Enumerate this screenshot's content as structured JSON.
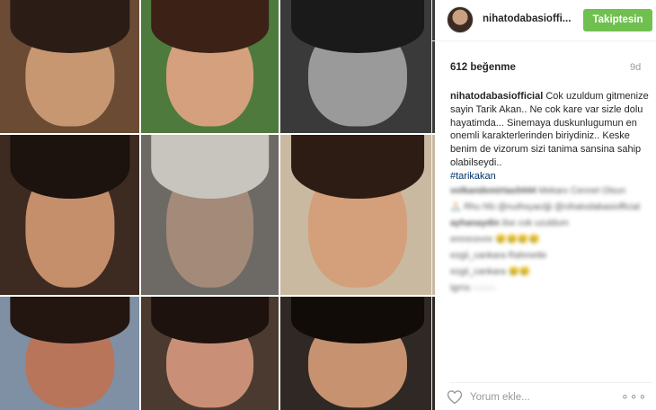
{
  "collage": {
    "tiles": [
      {
        "bg": "#6b4b34",
        "skin": "#c79772",
        "hair": "#2b1d16"
      },
      {
        "bg": "#4f7a3e",
        "skin": "#d4a07d",
        "hair": "#3c2116"
      },
      {
        "bg": "#3a3a3a",
        "skin": "#9a9a9a",
        "hair": "#1a1a1a"
      },
      {
        "bg": "#3d2b22",
        "skin": "#c58f6c",
        "hair": "#1c120e"
      },
      {
        "bg": "#6d6a66",
        "skin": "#a48a78",
        "hair": "#c8c4be"
      },
      {
        "bg": "#c9b9a1",
        "skin": "#d49f7b",
        "hair": "#2d1c14"
      },
      {
        "bg": "#7f8fa4",
        "skin": "#b8755a",
        "hair": "#23150f"
      },
      {
        "bg": "#4b3a30",
        "skin": "#c99077",
        "hair": "#1d120d"
      },
      {
        "bg": "#2f2824",
        "skin": "#c6926f",
        "hair": "#120c09"
      }
    ]
  },
  "header": {
    "username": "nihatodabasioffi...",
    "follow_label": "Takiptesin"
  },
  "meta": {
    "likes": "612 beğenme",
    "age": "9d"
  },
  "caption": {
    "user": "nihatodabasiofficial",
    "text": "Cok uzuldum gitmenize sayin Tarik Akan.. Ne cok kare var sizle dolu hayatimda... Sinemaya duskunlugumun en onemli karakterlerinden biriydiniz.. Keske benim de vizorum sizi tanima sansina sahip olabilseydi..",
    "hashtag": "#tarikakan"
  },
  "comments": [
    {
      "user": "volkandemirtas5444",
      "text": "Mekanı Cennet Olsun"
    },
    {
      "user": "",
      "text": "🙏🏻 Rhu hfü @nuthsyaciği"
    },
    {
      "user": "",
      "text": "@nihatodabasiofficial"
    },
    {
      "user": "ayhanaydin",
      "text": "ilse cok uzuldum"
    },
    {
      "user": "",
      "text": "emrecevre 😢😢😢😢"
    },
    {
      "user": "",
      "text": "ezgii_cankara Rahmetle"
    },
    {
      "user": "",
      "text": "ezgii_cankara 😢😢"
    },
    {
      "user": "",
      "text": "tgrns ∴∴∴∴"
    }
  ],
  "footer": {
    "comment_placeholder": "Yorum ekle...",
    "more_label": "∘∘∘"
  },
  "colors": {
    "follow_button": "#70c050",
    "hashtag": "#003569",
    "muted": "#999999"
  }
}
